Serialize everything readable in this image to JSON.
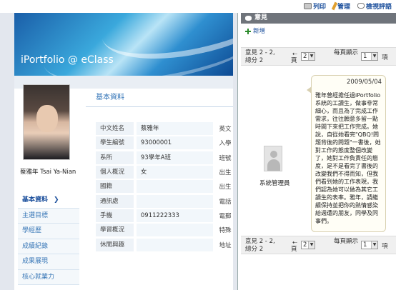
{
  "toolbar": {
    "print_label": "列印",
    "manage_label": "管理",
    "comments_label": "檢視評語"
  },
  "portfolio": {
    "banner_title": "iPortfolio @ eClass",
    "student_name": "蔡雅年 Tsai Ya-Nian",
    "nav": [
      {
        "label": "基本資料",
        "active": true
      },
      {
        "label": "主選目標",
        "active": false
      },
      {
        "label": "學經歷",
        "active": false
      },
      {
        "label": "成績紀錄",
        "active": false
      },
      {
        "label": "成果展現",
        "active": false
      },
      {
        "label": "核心就業力",
        "active": false
      }
    ],
    "section_title": "基本資料",
    "fields": [
      {
        "label": "中文姓名",
        "value": "蔡雅年",
        "extra": "英文"
      },
      {
        "label": "學生編號",
        "value": "93000001",
        "extra": "入學"
      },
      {
        "label": "系所",
        "value": "93學年A班",
        "extra": "班號"
      },
      {
        "label": "個人概況",
        "value": "女",
        "extra": "出生"
      },
      {
        "label": "國籍",
        "value": "",
        "extra": "出生"
      },
      {
        "label": "通訊處",
        "value": "",
        "extra": "電話"
      },
      {
        "label": "手機",
        "value": "0911222333",
        "extra": "電郵"
      },
      {
        "label": "學習概況",
        "value": "",
        "extra": "特殊"
      },
      {
        "label": "休閒興趣",
        "value": "",
        "extra": "地址"
      }
    ]
  },
  "comments": {
    "header": "意見",
    "add_label": "新增",
    "pager_top": {
      "info": "意見 2 - 2, 總分 2",
      "page_label": "頁",
      "page_value": "2",
      "per_page_label": "每頁顯示",
      "per_page_value": "1",
      "item_label": "項"
    },
    "pager_bottom": {
      "info": "意見 2 - 2, 總分 2",
      "page_label": "頁",
      "page_value": "2",
      "per_page_label": "每頁顯示",
      "per_page_value": "1",
      "item_label": "項"
    },
    "author": "系統管理員",
    "date": "2009/05/04",
    "body": "雅年曾經擔任過iPortfolio系統的工讀生，做事非常細心，而且為了完成工作需求，往往願意多留一點時間下來把工作完成。她說，自從她看完\"QBQ!問題背後的問題\"一書後，她對工作的態度整個改變了，她對工作負責任的態度，是不是看完了書後的改變我們不得而知，但我們看到她的工作表現，我們認為她可以做為其它工讀生的表率。雅年，請繼續保持並把你的熱情感染給週遭的朋友，同學及同事們。"
  }
}
